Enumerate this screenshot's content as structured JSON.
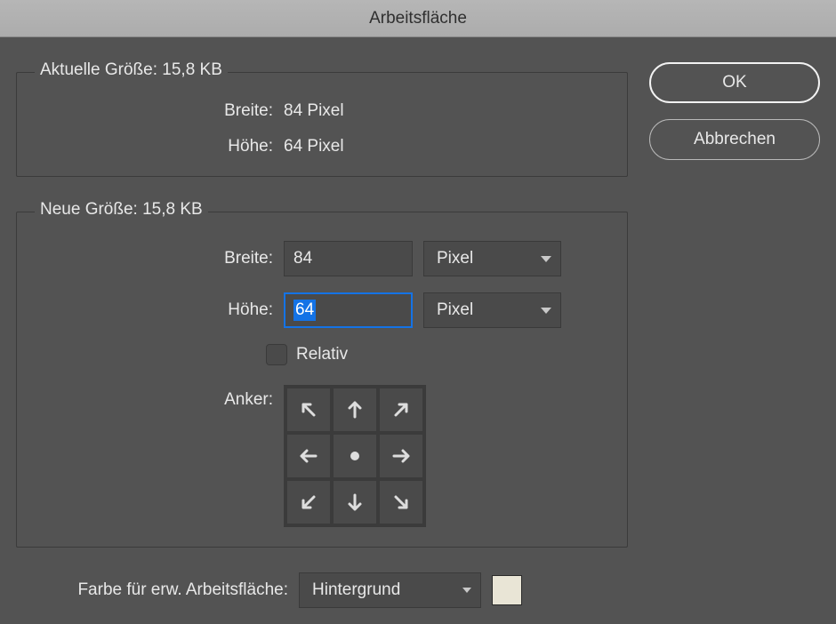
{
  "title": "Arbeitsfläche",
  "buttons": {
    "ok": "OK",
    "cancel": "Abbrechen"
  },
  "currentSize": {
    "legend": "Aktuelle Größe: 15,8 KB",
    "widthLabel": "Breite:",
    "widthValue": "84 Pixel",
    "heightLabel": "Höhe:",
    "heightValue": "64 Pixel"
  },
  "newSize": {
    "legend": "Neue Größe: 15,8 KB",
    "widthLabel": "Breite:",
    "widthValue": "84",
    "widthUnit": "Pixel",
    "heightLabel": "Höhe:",
    "heightValue": "64",
    "heightUnit": "Pixel",
    "relativeLabel": "Relativ",
    "relativeChecked": false,
    "anchorLabel": "Anker:",
    "anchorPosition": "center"
  },
  "extension": {
    "label": "Farbe für erw. Arbeitsfläche:",
    "selected": "Hintergrund",
    "swatchColor": "#e9e5d6"
  }
}
